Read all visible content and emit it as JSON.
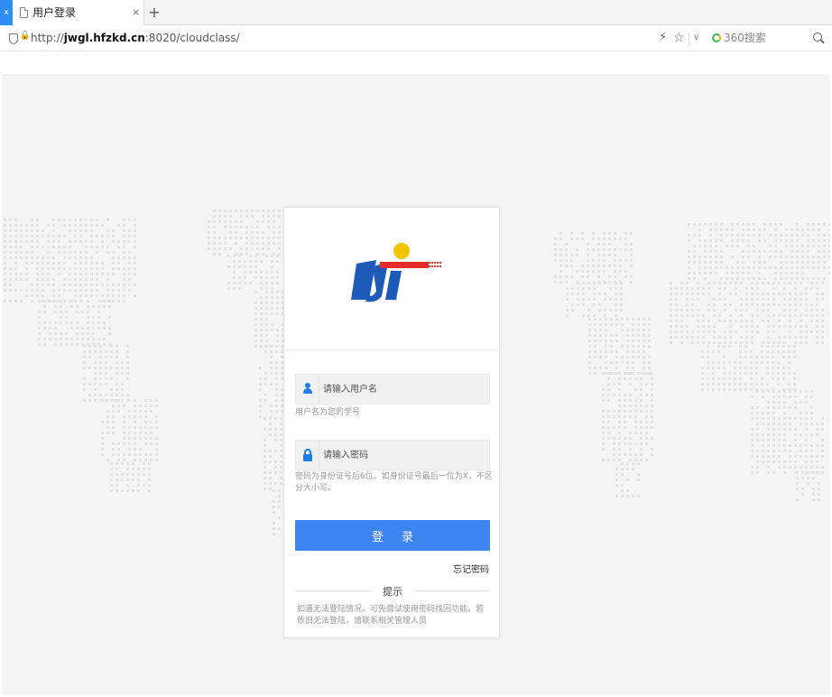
{
  "browser": {
    "tab_edge_label": "x",
    "tab_title": "用户登录",
    "tab_close": "×",
    "new_tab": "+",
    "url_prefix": "http://",
    "url_host": "jwgl.hfzkd.cn",
    "url_rest": ":8020/cloudclass/",
    "bolt_icon": "⚡",
    "star_icon": "☆",
    "dropdown_icon": "∨",
    "search_placeholder": "360搜索"
  },
  "login": {
    "username_placeholder": "请输入用户名",
    "username_hint": "用户名为您的学号",
    "password_placeholder": "请输入密码",
    "password_hint": "密码为身份证号后6位。如身份证号最后一位为X，不区分大小写。",
    "login_button": "登 录",
    "forgot_password": "忘记密码",
    "tips_title": "提示",
    "tips_body": "如遇无法登陆情况，可先尝试使用密码找回功能，若依旧无法登陆，请联系相关管理人员"
  },
  "colors": {
    "accent": "#3d86f2",
    "icon_blue": "#1f7fe6",
    "logo_blue": "#1e5bb8",
    "logo_red": "#e52b2b",
    "logo_yellow": "#f5c400"
  }
}
